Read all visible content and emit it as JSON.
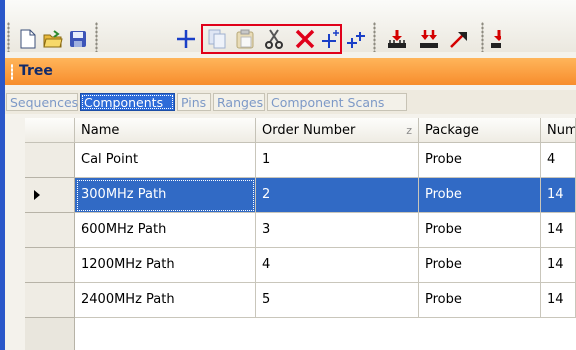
{
  "toolbar": {
    "buttons": [
      {
        "icon": "new-document-icon"
      },
      {
        "icon": "open-folder-icon"
      },
      {
        "icon": "save-icon"
      },
      {
        "icon": "add-icon"
      },
      {
        "icon": "copy-icon"
      },
      {
        "icon": "paste-icon"
      },
      {
        "icon": "cut-icon"
      },
      {
        "icon": "delete-icon"
      },
      {
        "icon": "add-plus-icon"
      },
      {
        "icon": "add-multiple-icon"
      },
      {
        "icon": "download-icon"
      },
      {
        "icon": "download-multiple-icon"
      },
      {
        "icon": "export-arrow-icon"
      },
      {
        "icon": "import-icon"
      }
    ],
    "highlight_color": "#e0001a"
  },
  "tree": {
    "title": "Tree"
  },
  "tabs": [
    "Sequences",
    "Components",
    "Pins",
    "Ranges",
    "Component Scans"
  ],
  "active_tab": "Components",
  "table": {
    "columns": [
      "Name",
      "Order Number",
      "Package",
      "Num"
    ],
    "sort_indicator": "z",
    "rows": [
      {
        "name": "Cal Point",
        "order": "1",
        "package": "Probe",
        "num": "4"
      },
      {
        "name": "300MHz Path",
        "order": "2",
        "package": "Probe",
        "num": "14"
      },
      {
        "name": "600MHz Path",
        "order": "3",
        "package": "Probe",
        "num": "14"
      },
      {
        "name": "1200MHz Path",
        "order": "4",
        "package": "Probe",
        "num": "14"
      },
      {
        "name": "2400MHz Path",
        "order": "5",
        "package": "Probe",
        "num": "14"
      }
    ],
    "selected_row": 1
  },
  "colors": {
    "accent": "#316ac5",
    "tree_header": "#f78d2d"
  }
}
